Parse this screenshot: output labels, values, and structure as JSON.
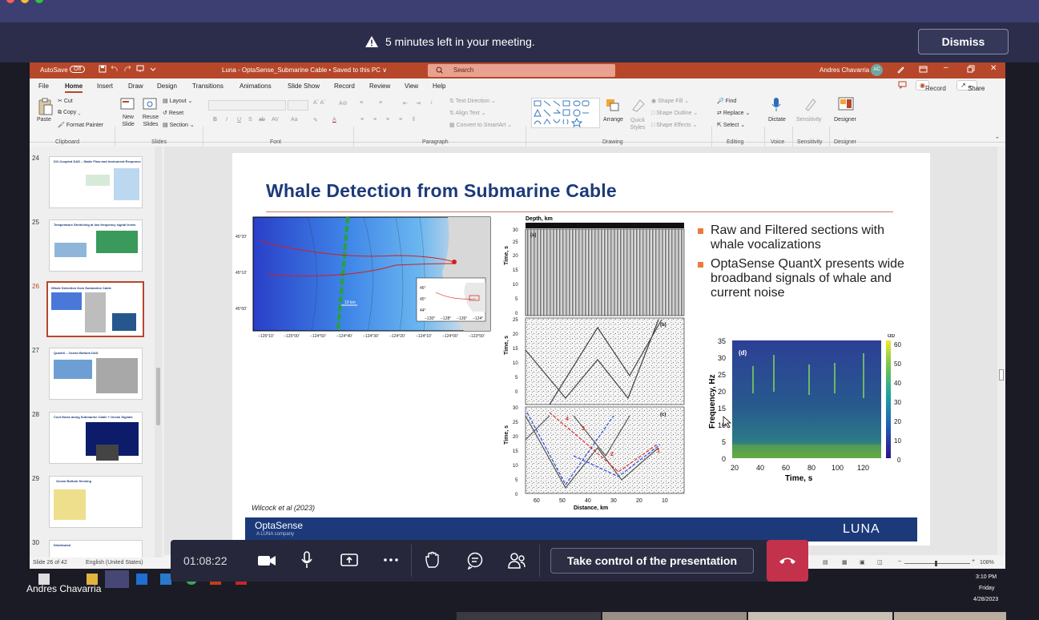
{
  "banner": {
    "message": "5 minutes left in your meeting.",
    "dismiss_label": "Dismiss"
  },
  "ppt": {
    "autosave": "AutoSave",
    "autosave_state": "Off",
    "doc_title": "Luna - OptaSense_Submarine Cable • Saved to this PC ∨",
    "search_placeholder": "Search",
    "user_name": "Andres Chavarria",
    "user_initials": "AC",
    "tabs": [
      "File",
      "Home",
      "Insert",
      "Draw",
      "Design",
      "Transitions",
      "Animations",
      "Slide Show",
      "Record",
      "Review",
      "View",
      "Help"
    ],
    "active_tab": "Home",
    "record_label": "Record",
    "share_label": "Share",
    "ribbon": {
      "clipboard": {
        "paste": "Paste",
        "cut": "Cut",
        "copy": "Copy",
        "format_painter": "Format Painter",
        "group": "Clipboard"
      },
      "slides": {
        "new_slide": "New Slide",
        "reuse": "Reuse Slides",
        "layout": "Layout",
        "reset": "Reset",
        "section": "Section",
        "group": "Slides"
      },
      "font_group": "Font",
      "paragraph": {
        "text_direction": "Text Direction",
        "align_text": "Align Text",
        "convert": "Convert to SmartArt",
        "group": "Paragraph"
      },
      "drawing": {
        "arrange": "Arrange",
        "quick_styles": "Quick Styles",
        "shape_fill": "Shape Fill",
        "shape_outline": "Shape Outline",
        "shape_effects": "Shape Effects",
        "group": "Drawing"
      },
      "editing": {
        "find": "Find",
        "replace": "Replace",
        "select": "Select",
        "group": "Editing"
      },
      "voice": {
        "dictate": "Dictate",
        "group": "Voice"
      },
      "sensitivity": {
        "label": "Sensitivity",
        "group": "Sensitivity"
      },
      "designer": {
        "label": "Designer",
        "group": "Designer"
      }
    },
    "thumb_numbers": [
      "24",
      "25",
      "26",
      "27",
      "28",
      "29",
      "30"
    ],
    "thumb_titles": [
      "DO-Coupled DAS – Static Flow and Instrument Response",
      "Temperature Stretching at low frequency signal levels",
      "Whale Detection from Submarine Cable",
      "QuantX – Ocean Bottom DAS",
      "Cool Noise along Submarine Cable + Ocean Signals",
      "Ocean Bottom Sensing",
      "Distributed"
    ],
    "selected_slide": "26",
    "status_slide": "Slide 26 of 42",
    "status_lang": "English (United States)",
    "zoom": "108%"
  },
  "slide": {
    "title": "Whale Detection from Submarine Cable",
    "bullets": [
      "Raw and Filtered sections with whale vocalizations",
      "OptaSense QuantX presents wide broadband signals of whale and current noise"
    ],
    "citation": "Wilcock et al (2023)",
    "footer_brand": "OptaSense",
    "footer_sub": "A LUNA company",
    "footer_logo": "LUNA",
    "map_lat_labels": [
      "45°20'",
      "45°10'",
      "45°00'"
    ],
    "map_lon_labels": [
      "−125°10'",
      "−125°00'",
      "−124°50'",
      "−124°40'",
      "−124°30'",
      "−124°20'",
      "−124°10'",
      "−124°00'",
      "−123°50'"
    ],
    "map_scale": "10 km",
    "inset_lat": [
      "46°",
      "45°",
      "44°"
    ],
    "inset_lon": [
      "−130°",
      "−128°",
      "−126°",
      "−124°"
    ],
    "depth_label": "Depth, km",
    "panel_labels": [
      "(a)",
      "(b)",
      "(c)",
      "(d)"
    ],
    "time_label": "Time, s",
    "time_ticks": [
      "30",
      "25",
      "20",
      "15",
      "10",
      "5",
      "0"
    ],
    "distance_ticks": [
      "60",
      "50",
      "40",
      "30",
      "20",
      "10"
    ],
    "distance_label": "Distance, km",
    "whale_numbers": [
      "4",
      "3",
      "2",
      "1"
    ],
    "spec_y_ticks": [
      "35",
      "30",
      "25",
      "20",
      "15",
      "10",
      "5",
      "0"
    ],
    "spec_x_ticks": [
      "20",
      "40",
      "60",
      "80",
      "100",
      "120"
    ],
    "spec_ylabel": "Frequency, Hz",
    "spec_xlabel": "Time, s",
    "cbar_unit": "db",
    "cbar_ticks": [
      "60",
      "50",
      "40",
      "30",
      "20",
      "10",
      "0"
    ]
  },
  "teams": {
    "timer": "01:08:22",
    "take_control": "Take control of the presentation"
  },
  "taskbar": {
    "presenter_name": "Andres Chavarria",
    "time": "3:10 PM",
    "day": "Friday",
    "date": "4/28/2023"
  }
}
